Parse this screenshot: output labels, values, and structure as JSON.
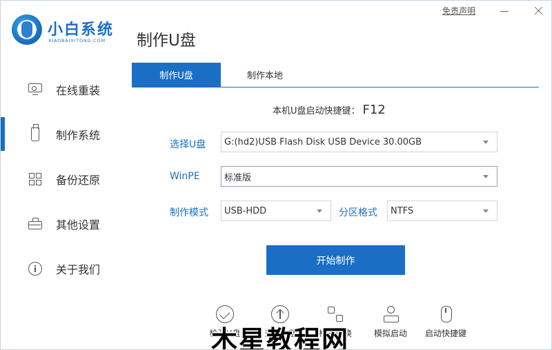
{
  "brand": {
    "name": "小白系统",
    "subtitle": "XIAOBAIXITONG.COM"
  },
  "header": {
    "page_title": "制作U盘",
    "disclaimer": "免责声明",
    "minimize_icon": "minimize-icon",
    "close_icon": "close-icon"
  },
  "sidebar": {
    "items": [
      {
        "label": "在线重装",
        "icon": "monitor-icon",
        "active": false
      },
      {
        "label": "制作系统",
        "icon": "usb-drive-icon",
        "active": true
      },
      {
        "label": "备份还原",
        "icon": "grid-icon",
        "active": false
      },
      {
        "label": "其他设置",
        "icon": "briefcase-icon",
        "active": false
      },
      {
        "label": "关于我们",
        "icon": "info-icon",
        "active": false
      }
    ]
  },
  "tabs": [
    {
      "label": "制作U盘",
      "active": true
    },
    {
      "label": "制作本地",
      "active": false
    }
  ],
  "shortcut": {
    "label": "本机U盘启动快捷键：",
    "key": "F12"
  },
  "form": {
    "usb_label": "选择U盘",
    "usb_value": "G:(hd2)USB Flash Disk USB Device 30.00GB",
    "winpe_label": "WinPE",
    "winpe_value": "标准版",
    "mode_label": "制作模式",
    "mode_value": "USB-HDD",
    "partition_label": "分区格式",
    "partition_value": "NTFS"
  },
  "start_button": "开始制作",
  "toolbar": [
    {
      "label": "检测U盘",
      "icon": "check-circle-icon"
    },
    {
      "label": "升级U盘",
      "icon": "upgrade-icon"
    },
    {
      "label": "格式转换",
      "icon": "convert-icon"
    },
    {
      "label": "模拟启动",
      "icon": "simulate-boot-icon"
    },
    {
      "label": "启动快捷键",
      "icon": "mouse-icon"
    }
  ],
  "watermark": "木星教程网"
}
